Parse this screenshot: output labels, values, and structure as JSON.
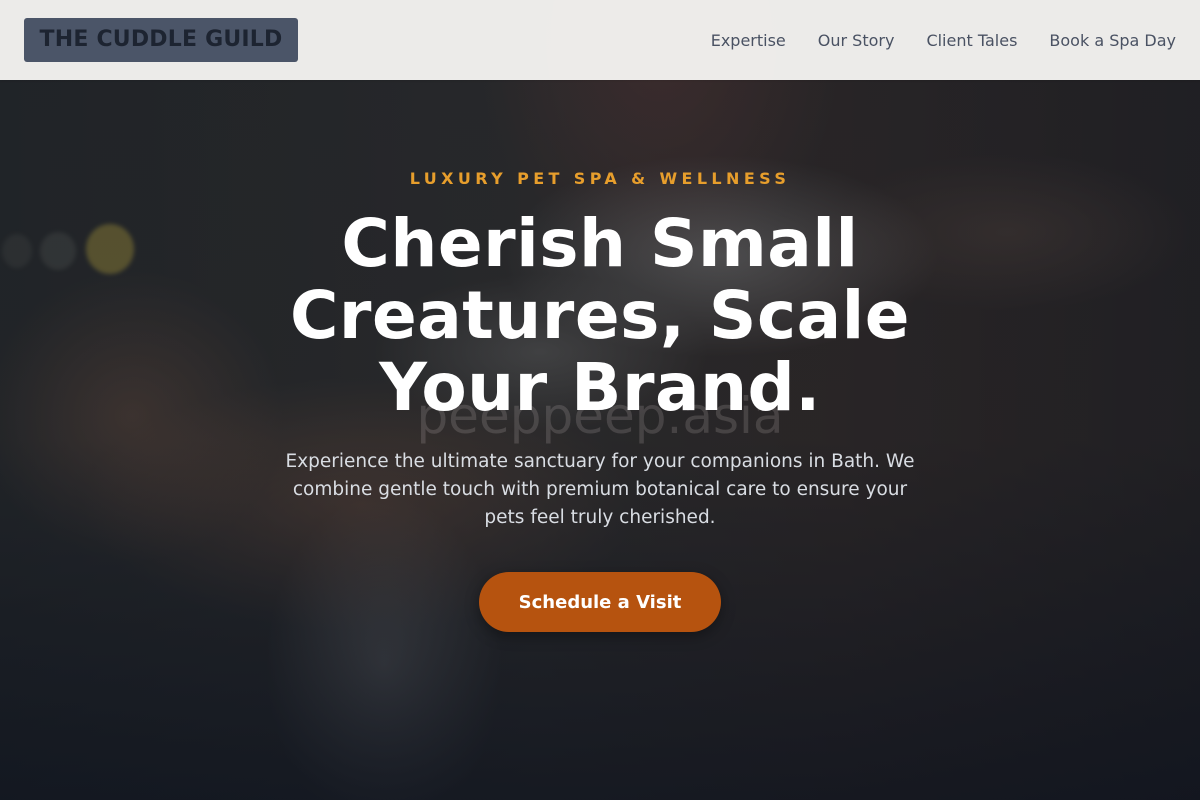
{
  "brand": {
    "logo_text": "THE CUDDLE GUILD"
  },
  "nav": {
    "items": [
      {
        "label": "Expertise"
      },
      {
        "label": "Our Story"
      },
      {
        "label": "Client Tales"
      },
      {
        "label": "Book a Spa Day"
      }
    ]
  },
  "hero": {
    "eyebrow": "LUXURY PET SPA & WELLNESS",
    "headline": "Cherish Small Creatures, Scale Your Brand.",
    "watermark": "peeppeep.asia",
    "lede": "Experience the ultimate sanctuary for your companions in Bath. We combine gentle touch with premium botanical care to ensure your pets feel truly cherished.",
    "cta_label": "Schedule a Visit"
  },
  "colors": {
    "accent": "#e79e2c",
    "cta": "#b6530f",
    "logo_bg": "#4b5568",
    "nav_text": "#4a5263",
    "overlay": "#171e2a"
  }
}
